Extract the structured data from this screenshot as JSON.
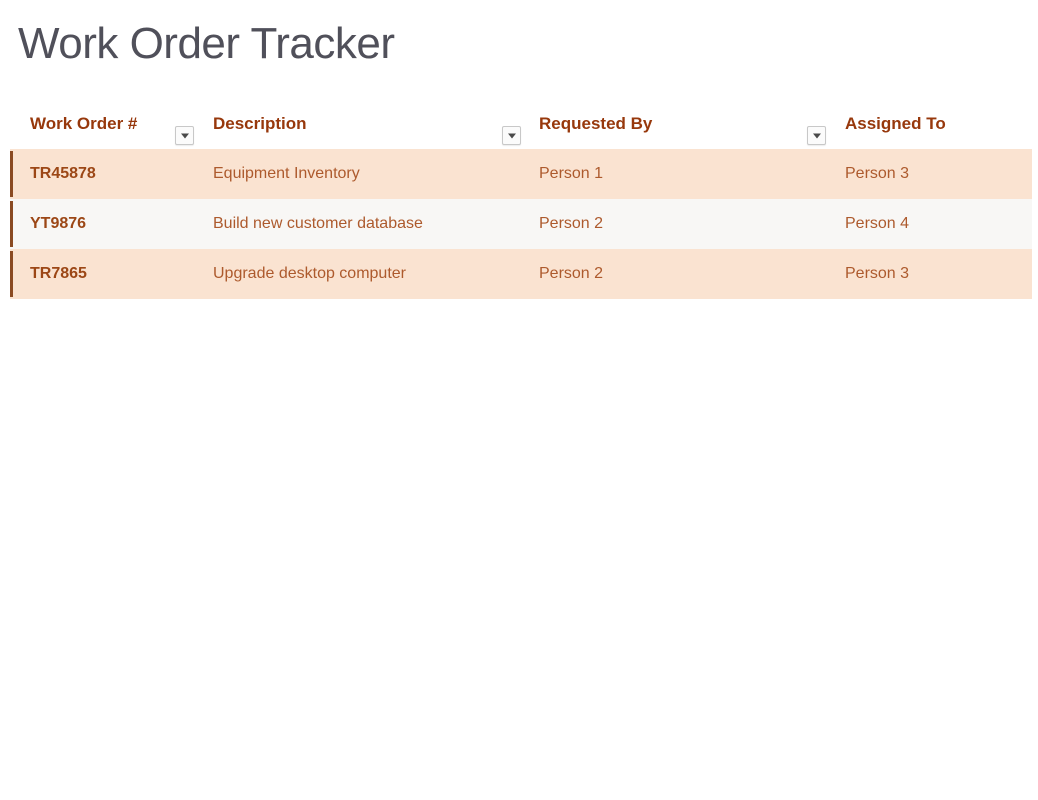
{
  "document": {
    "title": "Work Order Tracker"
  },
  "table": {
    "columns": [
      {
        "label": "Work Order #",
        "has_filter": true,
        "filter_icon": "chevron-down-icon"
      },
      {
        "label": "Description",
        "has_filter": true,
        "filter_icon": "chevron-down-icon"
      },
      {
        "label": "Requested By",
        "has_filter": true,
        "filter_icon": "chevron-down-icon"
      },
      {
        "label": "Assigned To",
        "has_filter": false,
        "filter_icon": ""
      }
    ],
    "rows": [
      {
        "work_order": "TR45878",
        "description": "Equipment Inventory",
        "requested_by": "Person 1",
        "assigned_to": "Person 3"
      },
      {
        "work_order": "YT9876",
        "description": "Build new customer database",
        "requested_by": "Person 2",
        "assigned_to": "Person 4"
      },
      {
        "work_order": "TR7865",
        "description": "Upgrade desktop computer",
        "requested_by": "Person 2",
        "assigned_to": "Person 3"
      }
    ]
  },
  "colors": {
    "title_text": "#50505a",
    "header_text": "#97380c",
    "cell_text": "#ad5a2d",
    "cell_text_bold": "#9c4716",
    "row_odd_background": "#fae3d1",
    "row_even_background": "#f8f7f5",
    "row_accent": "#8a4a22",
    "page_background": "#ffffff"
  }
}
